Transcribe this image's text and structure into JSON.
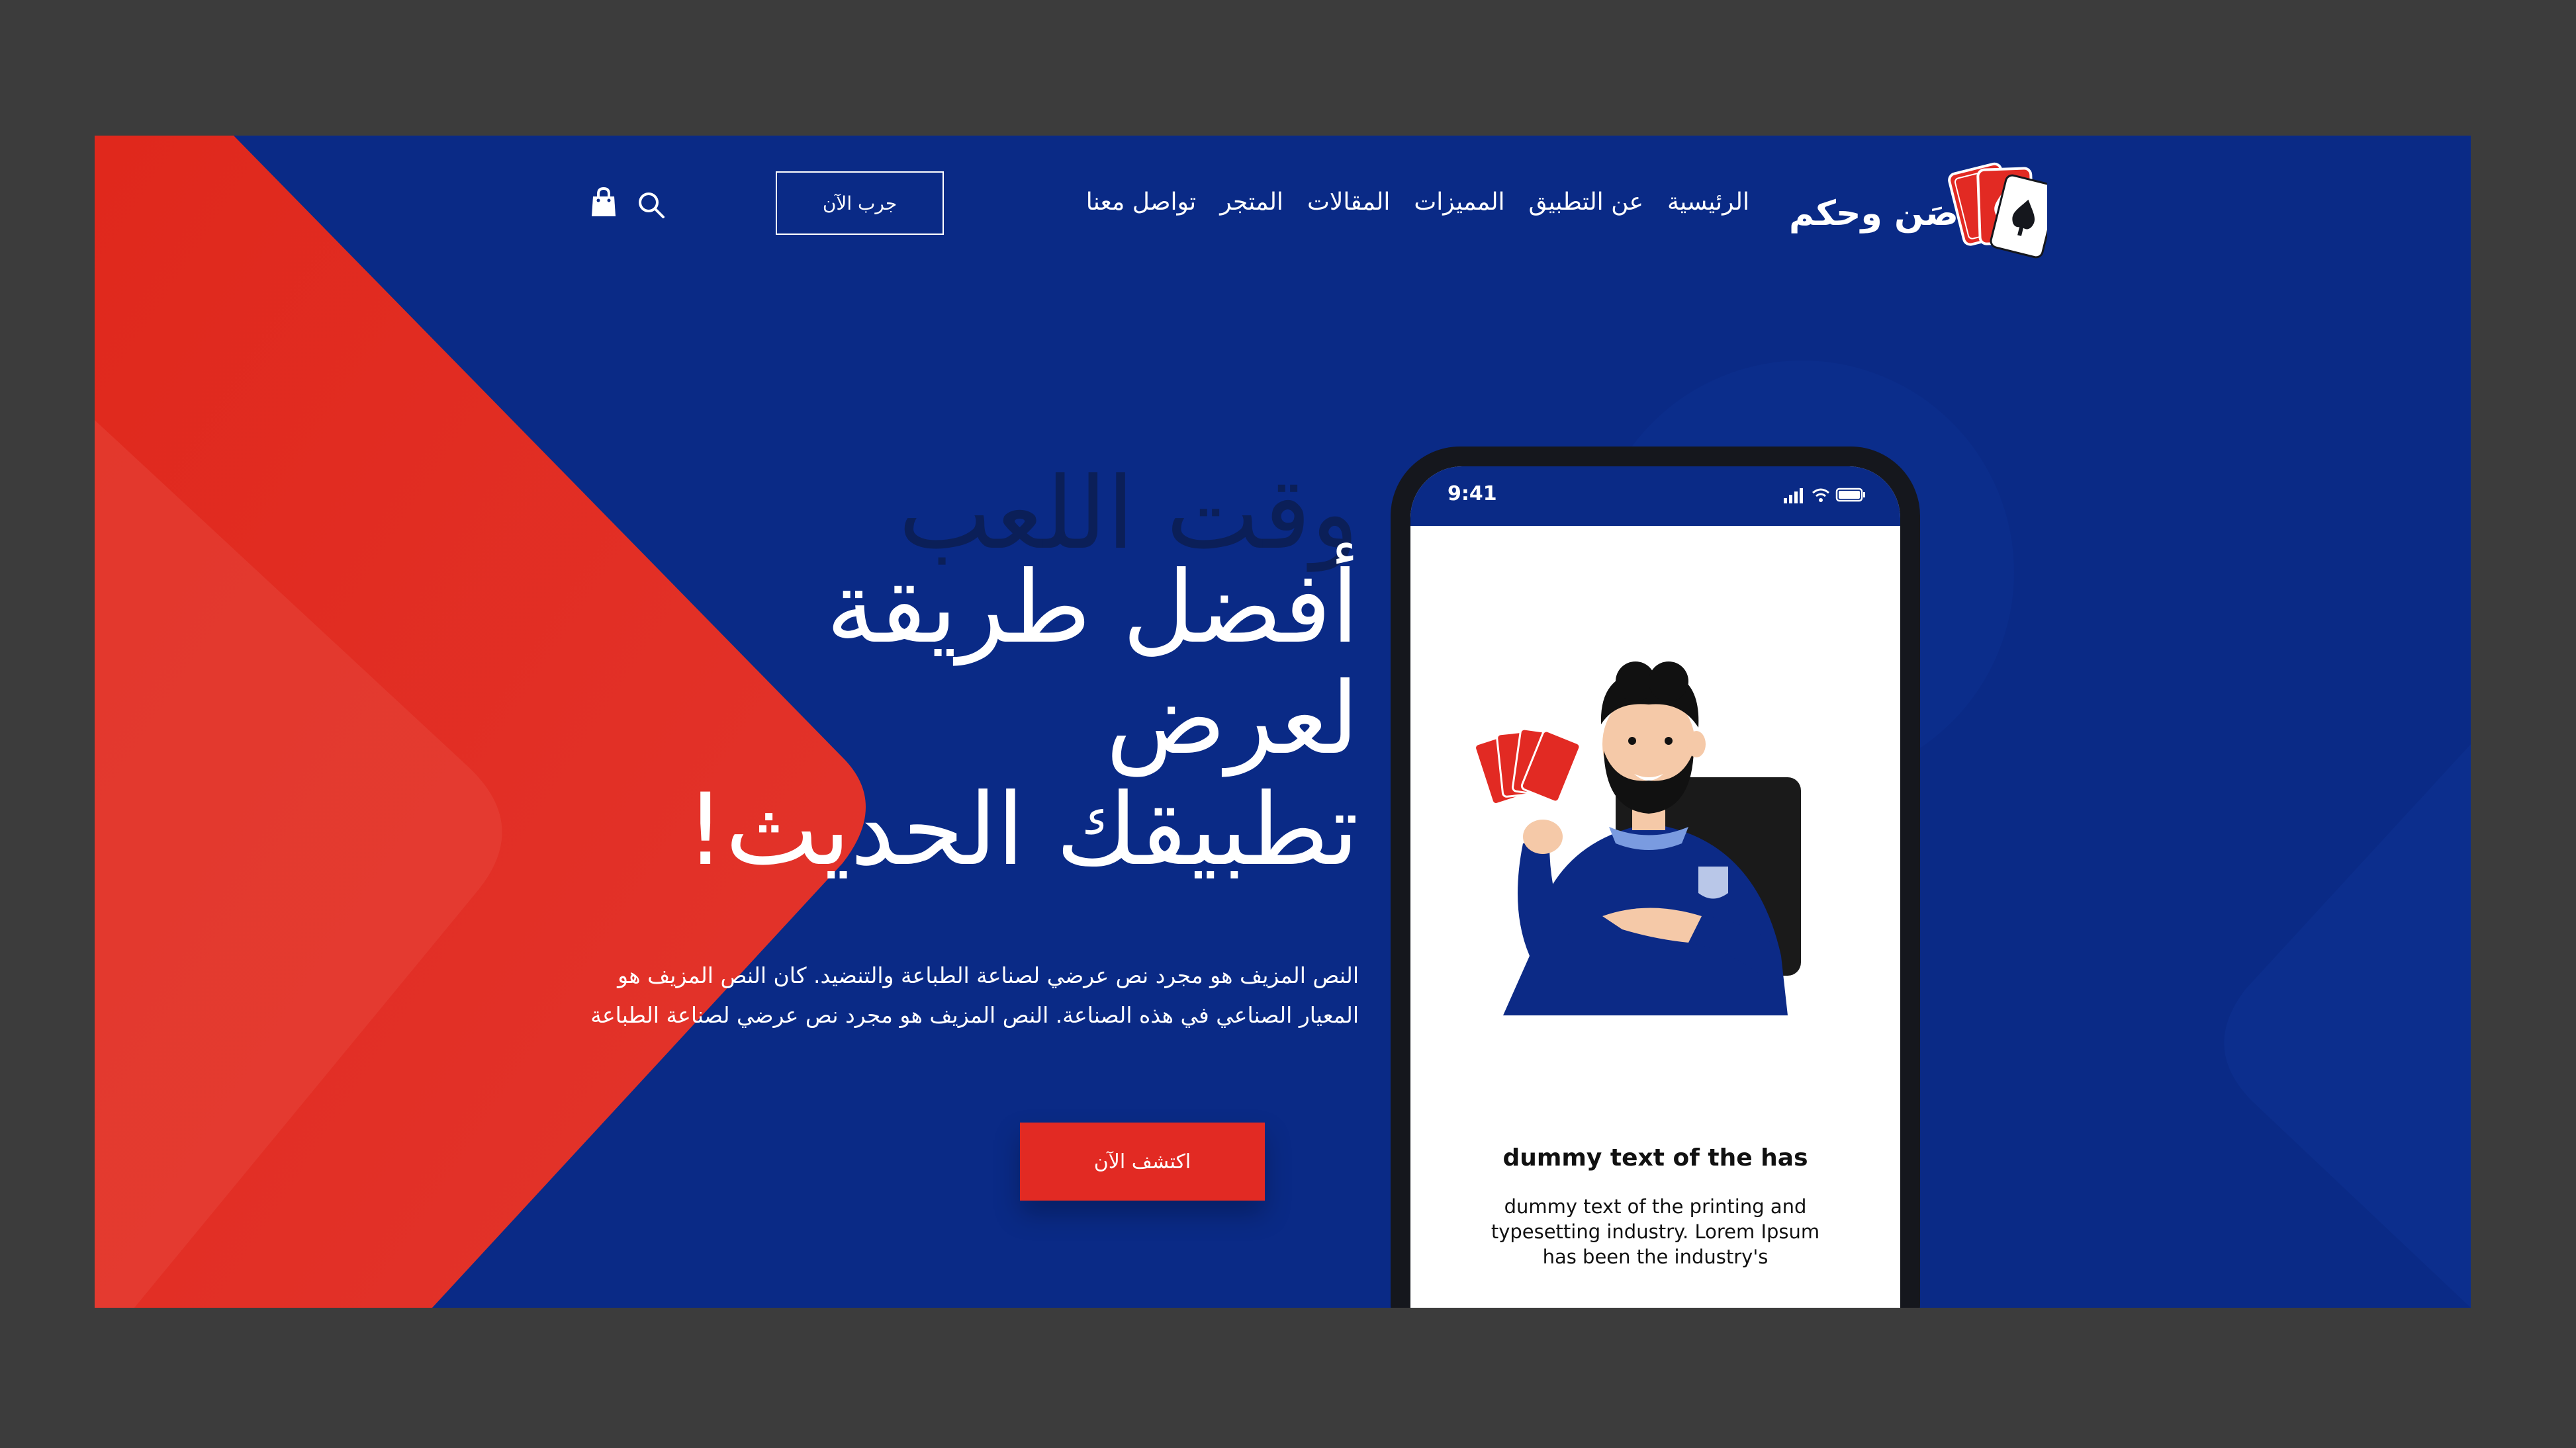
{
  "brand": {
    "name": "صَن وحكم"
  },
  "nav": {
    "items": [
      {
        "label": "الرئيسية"
      },
      {
        "label": "عن التطبيق"
      },
      {
        "label": "المميزات"
      },
      {
        "label": "المقالات"
      },
      {
        "label": "المتجر"
      },
      {
        "label": "تواصل معنا"
      }
    ],
    "cta_label": "جرب الآن"
  },
  "hero": {
    "background_title": "وقت اللعب",
    "title_lines": [
      "أفضل طريقة",
      "لعرض",
      "تطبيقك الحديث!"
    ],
    "description": "النص المزيف هو مجرد نص عرضي لصناعة الطباعة والتنضيد. كان النص المزيف هو المعيار الصناعي في هذه الصناعة. النص المزيف هو مجرد نص عرضي لصناعة الطباعة",
    "cta_label": "اكتشف الآن"
  },
  "phone": {
    "time": "9:41",
    "screen_title": "dummy text of the has",
    "screen_description": "dummy text of the printing and typesetting industry. Lorem Ipsum has been the industry's"
  },
  "colors": {
    "blue": "#0a2a86",
    "red": "#e22a23",
    "dark_text": "#0b1f58"
  },
  "icons": {
    "search": "search-icon",
    "cart": "shopping-bag-icon",
    "logo": "playing-cards-icon"
  }
}
